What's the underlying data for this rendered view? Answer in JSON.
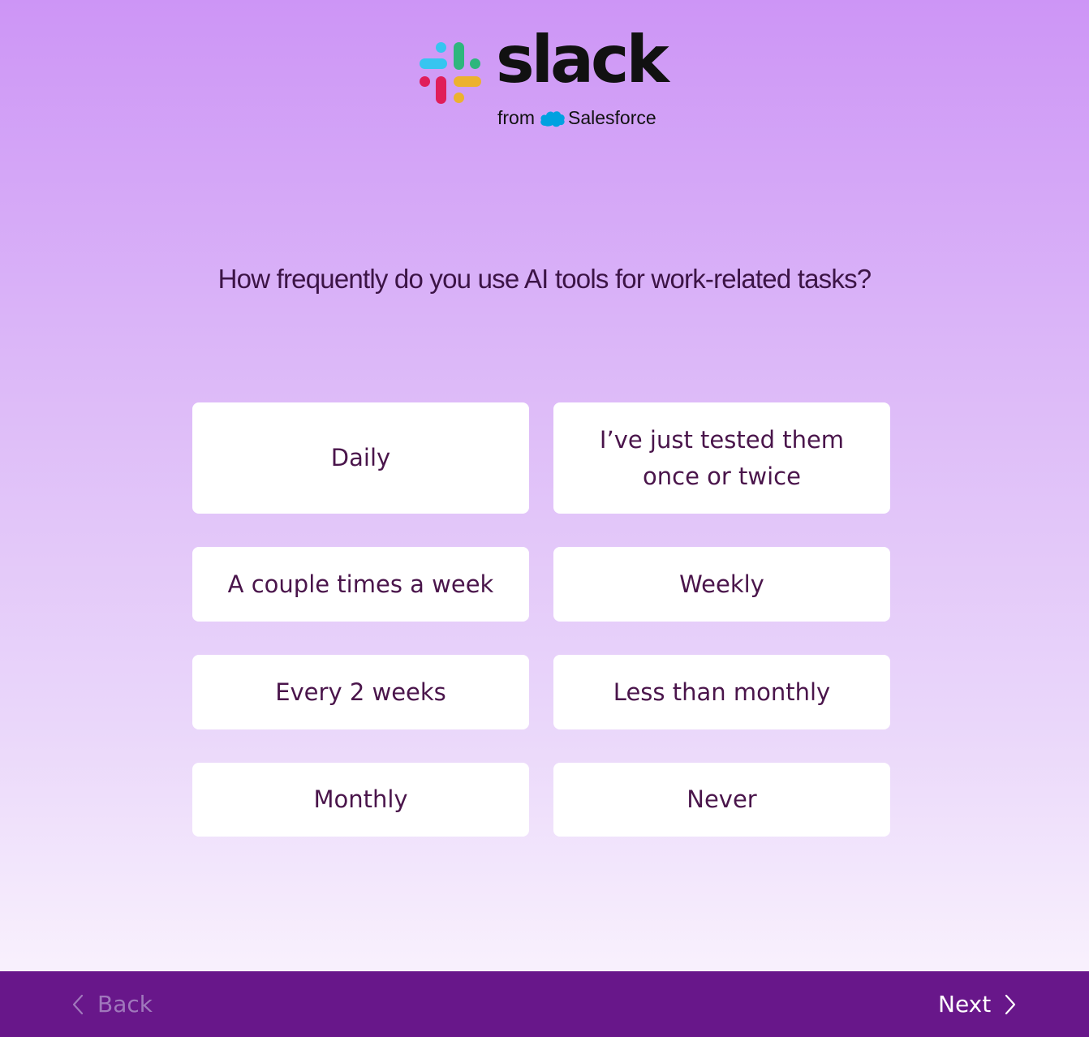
{
  "brand": {
    "wordmark": "slack",
    "from_text": "from",
    "partner": "Salesforce",
    "colors": {
      "blue": "#36c5f0",
      "green": "#2eb67d",
      "red": "#e01e5a",
      "yellow": "#ecb22e",
      "salesforce_blue": "#00a1e0"
    }
  },
  "question": {
    "text": "How frequently do you use AI tools for work-related tasks?"
  },
  "options": [
    {
      "label": "Daily"
    },
    {
      "label": "I’ve just tested them once or twice"
    },
    {
      "label": "A couple times a week"
    },
    {
      "label": "Weekly"
    },
    {
      "label": "Every 2 weeks"
    },
    {
      "label": "Less than monthly"
    },
    {
      "label": "Monthly"
    },
    {
      "label": "Never"
    }
  ],
  "footer": {
    "back_label": "Back",
    "next_label": "Next",
    "back_icon": "chevron-left-icon",
    "next_icon": "chevron-right-icon",
    "background": "#68178a"
  }
}
